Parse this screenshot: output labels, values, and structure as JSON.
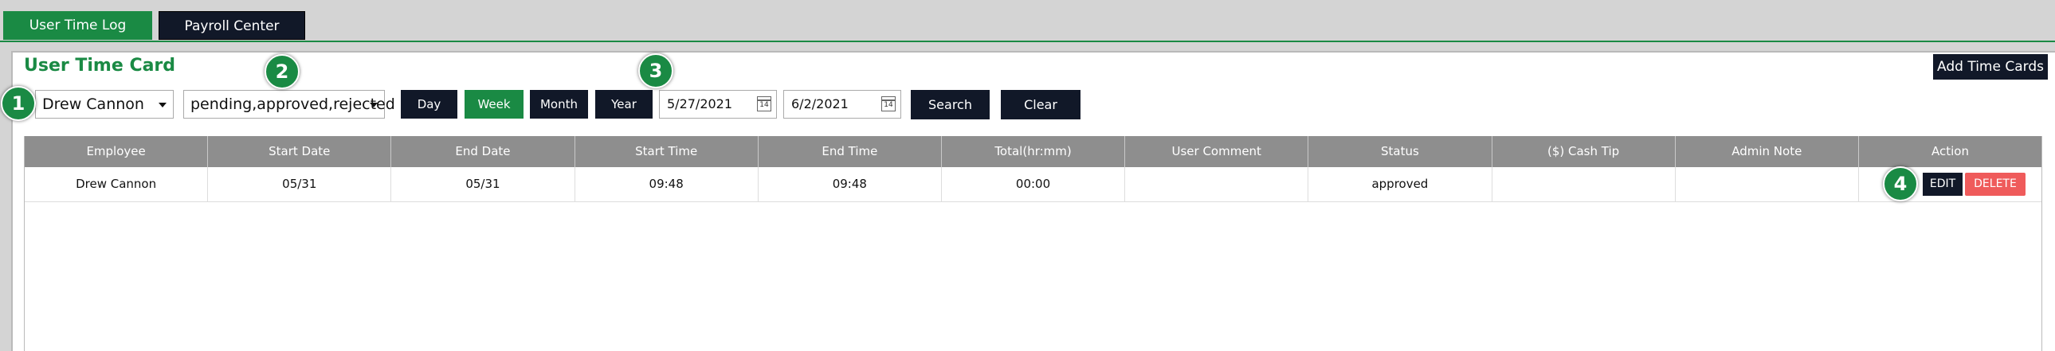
{
  "tabs": [
    {
      "label": "User Time Log",
      "active": true
    },
    {
      "label": "Payroll Center",
      "active": false
    }
  ],
  "page": {
    "title": "User Time Card",
    "add_button": "Add Time Cards"
  },
  "filters": {
    "employee": "Drew Cannon",
    "status": "pending,approved,rejected",
    "range_buttons": [
      "Day",
      "Week",
      "Month",
      "Year"
    ],
    "active_range": "Week",
    "start_date": "5/27/2021",
    "end_date": "6/2/2021",
    "calendar_day": "14",
    "search_label": "Search",
    "clear_label": "Clear Search"
  },
  "badges": [
    "1",
    "2",
    "3",
    "4"
  ],
  "table": {
    "columns": [
      "Employee",
      "Start Date",
      "End Date",
      "Start Time",
      "End Time",
      "Total(hr:mm)",
      "User Comment",
      "Status",
      "($) Cash Tip",
      "Admin Note",
      "Action"
    ],
    "rows": [
      {
        "employee": "Drew Cannon",
        "start_date": "05/31",
        "end_date": "05/31",
        "start_time": "09:48",
        "end_time": "09:48",
        "total": "00:00",
        "user_comment": "",
        "status": "approved",
        "cash_tip": "",
        "admin_note": "",
        "edit_label": "EDIT",
        "delete_label": "DELETE"
      }
    ]
  },
  "colors": {
    "accent": "#1a8a44",
    "dark": "#111828",
    "danger": "#ef5b5b",
    "header_bg": "#8e8e8e"
  }
}
